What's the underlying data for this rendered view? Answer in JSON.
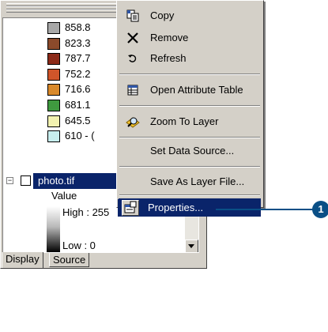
{
  "context_menu": {
    "items": [
      {
        "label": "Copy",
        "icon": "copy-icon",
        "mnemonic": "C"
      },
      {
        "label": "Remove",
        "icon": "remove-x-icon",
        "mnemonic": "R"
      },
      {
        "label": "Refresh",
        "icon": "refresh-icon",
        "mnemonic": "h"
      },
      {
        "label": "Open Attribute Table",
        "icon": "table-icon",
        "mnemonic": "T"
      },
      {
        "label": "Zoom To Layer",
        "icon": "zoom-to-layer-icon",
        "mnemonic": "Z"
      },
      {
        "label": "Set Data Source...",
        "mnemonic": "S"
      },
      {
        "label": "Save As Layer File...",
        "mnemonic": "y"
      },
      {
        "label": "Properties...",
        "icon": "properties-icon",
        "mnemonic": "i",
        "highlighted": true
      }
    ]
  },
  "toc": {
    "legend": [
      {
        "label": "858.8",
        "color": "#a8a8a8"
      },
      {
        "label": "823.3",
        "color": "#8b4a2b"
      },
      {
        "label": "787.7",
        "color": "#8c2a18"
      },
      {
        "label": "752.2",
        "color": "#d0552a"
      },
      {
        "label": "716.6",
        "color": "#d9892a"
      },
      {
        "label": "681.1",
        "color": "#3f9a3f"
      },
      {
        "label": "645.5",
        "color": "#f2f2b0"
      },
      {
        "label": "610 - (",
        "color": "#c8eeee"
      }
    ],
    "layer": {
      "name": "photo.tif"
    },
    "value_label": "Value",
    "high_label": "High : 255",
    "low_label": "Low : 0",
    "tabs": [
      "Display",
      "Source"
    ]
  },
  "callout": {
    "number": "1",
    "color": "#0a4f86"
  },
  "colors": {
    "selection": "#0a246a",
    "face": "#d4d0c8"
  }
}
